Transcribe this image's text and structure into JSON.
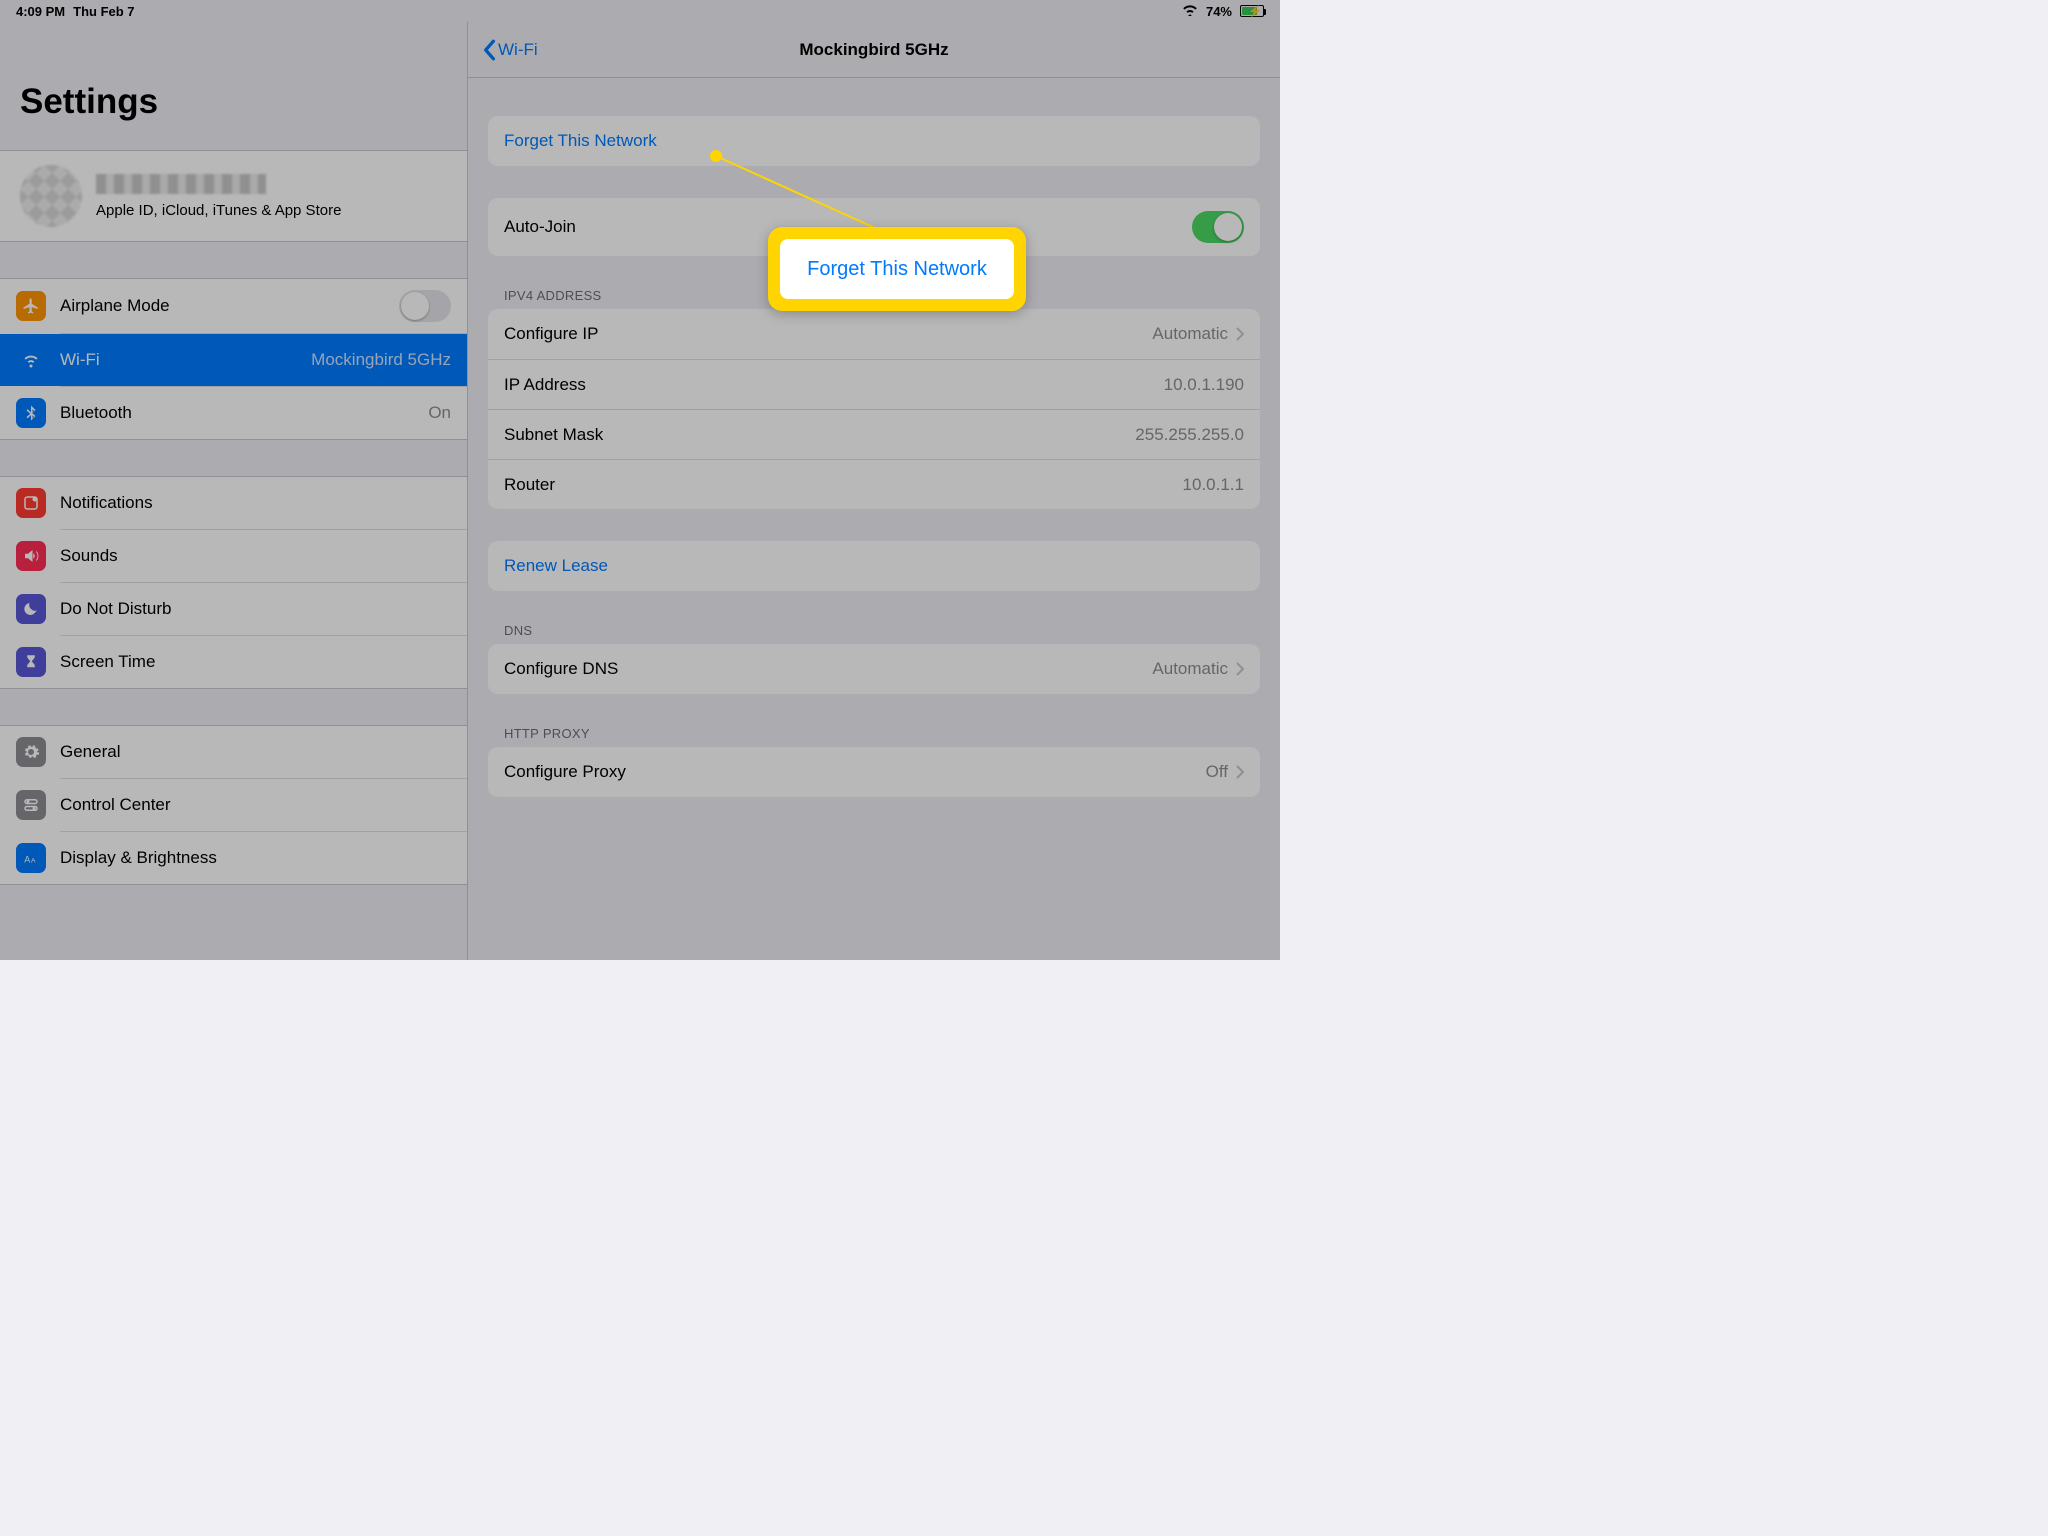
{
  "statusbar": {
    "time": "4:09 PM",
    "date": "Thu Feb 7",
    "battery_percent": "74%"
  },
  "sidebar": {
    "title": "Settings",
    "profile_subtitle": "Apple ID, iCloud, iTunes & App Store",
    "items": {
      "airplane": {
        "label": "Airplane Mode",
        "value": ""
      },
      "wifi": {
        "label": "Wi-Fi",
        "value": "Mockingbird 5GHz"
      },
      "bluetooth": {
        "label": "Bluetooth",
        "value": "On"
      },
      "notifications": {
        "label": "Notifications"
      },
      "sounds": {
        "label": "Sounds"
      },
      "dnd": {
        "label": "Do Not Disturb"
      },
      "screentime": {
        "label": "Screen Time"
      },
      "general": {
        "label": "General"
      },
      "controlcenter": {
        "label": "Control Center"
      },
      "display": {
        "label": "Display & Brightness"
      }
    }
  },
  "detail": {
    "back_label": "Wi-Fi",
    "title": "Mockingbird 5GHz",
    "forget": "Forget This Network",
    "autojoin_label": "Auto-Join",
    "ipv4_header": "IPV4 ADDRESS",
    "ipv4": {
      "configure_label": "Configure IP",
      "configure_value": "Automatic",
      "ip_label": "IP Address",
      "ip_value": "10.0.1.190",
      "mask_label": "Subnet Mask",
      "mask_value": "255.255.255.0",
      "router_label": "Router",
      "router_value": "10.0.1.1"
    },
    "renew": "Renew Lease",
    "dns_header": "DNS",
    "dns": {
      "label": "Configure DNS",
      "value": "Automatic"
    },
    "proxy_header": "HTTP PROXY",
    "proxy": {
      "label": "Configure Proxy",
      "value": "Off"
    }
  },
  "callout": {
    "text": "Forget This Network"
  }
}
